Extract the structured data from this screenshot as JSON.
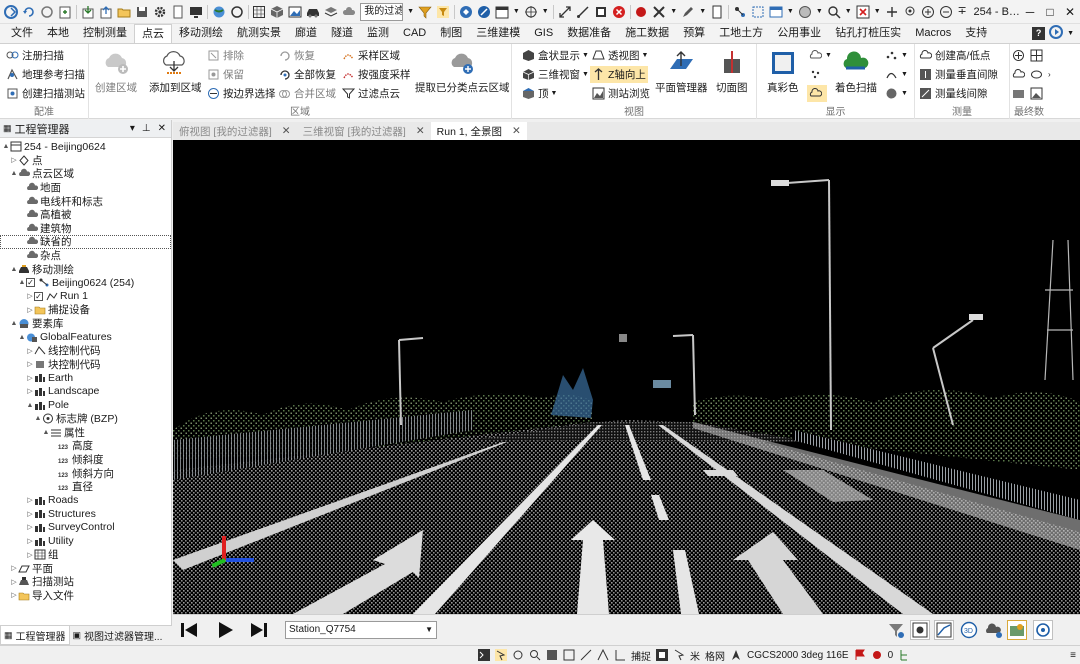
{
  "window": {
    "title": "254 - B…",
    "filter_combo": "我的过滤…"
  },
  "colors": {
    "ribbon_highlight": "#fde6a8",
    "accent_blue": "#2f6db5",
    "viewport_bg": "#000000",
    "road_white": "#e6e6e6"
  },
  "ribbon_tabs": [
    {
      "label": "文件"
    },
    {
      "label": "本地"
    },
    {
      "label": "控制测量"
    },
    {
      "label": "点云"
    },
    {
      "label": "移动测绘"
    },
    {
      "label": "航测实景"
    },
    {
      "label": "廊道"
    },
    {
      "label": "隧道"
    },
    {
      "label": "监测"
    },
    {
      "label": "CAD"
    },
    {
      "label": "制图"
    },
    {
      "label": "三维建模"
    },
    {
      "label": "GIS"
    },
    {
      "label": "数据准备"
    },
    {
      "label": "施工数据"
    },
    {
      "label": "预算"
    },
    {
      "label": "工地土方"
    },
    {
      "label": "公用事业"
    },
    {
      "label": "钻孔打桩压实"
    },
    {
      "label": "Macros"
    },
    {
      "label": "支持"
    }
  ],
  "ribbon": {
    "peizhun": {
      "label": "配准",
      "items": [
        {
          "label": "注册扫描",
          "icon": "register-scan-icon"
        },
        {
          "label": "地理参考扫描",
          "icon": "georeference-icon"
        },
        {
          "label": "创建扫描测站",
          "icon": "scan-station-icon"
        }
      ]
    },
    "quyu": {
      "label": "区域",
      "create_region": "创建区域",
      "add_to_region": "添加到区域",
      "small": [
        {
          "label": "排除",
          "icon": "exclude-icon"
        },
        {
          "label": "保留",
          "icon": "keep-icon"
        },
        {
          "label": "按边界选择",
          "icon": "boundary-select-icon"
        },
        {
          "label": "恢复",
          "icon": "restore-icon"
        },
        {
          "label": "全部恢复",
          "icon": "restore-all-icon"
        },
        {
          "label": "合并区域",
          "icon": "merge-region-icon"
        },
        {
          "label": "采样区域",
          "icon": "sample-region-icon"
        },
        {
          "label": "按强度采样",
          "icon": "intensity-sample-icon"
        },
        {
          "label": "过滤点云",
          "icon": "filter-cloud-icon"
        }
      ],
      "extract": "提取已分类点云区域"
    },
    "shitu": {
      "label": "视图",
      "small": [
        {
          "label": "盒状显示",
          "icon": "box-display-icon"
        },
        {
          "label": "三维视窗",
          "icon": "3d-window-icon"
        },
        {
          "label": "顶",
          "icon": "top-view-icon"
        },
        {
          "label": "透视图",
          "icon": "perspective-icon"
        },
        {
          "label": "Z轴向上",
          "icon": "z-up-icon"
        },
        {
          "label": "测站浏览",
          "icon": "station-browse-icon"
        }
      ],
      "plane_manager": "平面管理器",
      "cut_view": "切面图"
    },
    "xianshi": {
      "label": "显示",
      "true_color": "真彩色",
      "colored_scan": "着色扫描"
    },
    "celiang": {
      "label": "测量",
      "small": [
        {
          "label": "创建高/低点",
          "icon": "high-low-point-icon"
        },
        {
          "label": "测量垂直间隙",
          "icon": "vertical-clearance-icon"
        },
        {
          "label": "测量线间隙",
          "icon": "line-clearance-icon"
        }
      ]
    },
    "zuizhong": {
      "label": "最终数"
    }
  },
  "panel": {
    "title": "工程管理器",
    "tree": [
      {
        "label": "254 - Beijing0624",
        "icon": "project-icon"
      },
      {
        "label": "点",
        "icon": "point-icon"
      },
      {
        "label": "点云区域",
        "icon": "cloud-region-icon"
      },
      {
        "label": "地面",
        "icon": "cloud-region-icon"
      },
      {
        "label": "电线杆和标志",
        "icon": "cloud-region-icon"
      },
      {
        "label": "高植被",
        "icon": "cloud-region-icon"
      },
      {
        "label": "建筑物",
        "icon": "cloud-region-icon"
      },
      {
        "label": "缺省的",
        "icon": "cloud-region-icon"
      },
      {
        "label": "杂点",
        "icon": "cloud-region-icon"
      },
      {
        "label": "移动测绘",
        "icon": "mobile-mapping-icon"
      },
      {
        "label": "Beijing0624 (254)",
        "icon": "run-group-icon"
      },
      {
        "label": "Run 1",
        "icon": "run-icon"
      },
      {
        "label": "捕捉设备",
        "icon": "folder-icon"
      },
      {
        "label": "要素库",
        "icon": "feature-library-icon"
      },
      {
        "label": "GlobalFeatures",
        "icon": "global-features-icon"
      },
      {
        "label": "线控制代码",
        "icon": "line-code-icon"
      },
      {
        "label": "块控制代码",
        "icon": "block-code-icon"
      },
      {
        "label": "Earth",
        "icon": "feature-class-icon"
      },
      {
        "label": "Landscape",
        "icon": "feature-class-icon"
      },
      {
        "label": "Pole",
        "icon": "feature-class-icon"
      },
      {
        "label": "标志牌 (BZP)",
        "icon": "sign-feature-icon"
      },
      {
        "label": "属性",
        "icon": "attribute-list-icon"
      },
      {
        "label": "高度",
        "icon": "numeric-attribute-icon"
      },
      {
        "label": "倾斜度",
        "icon": "numeric-attribute-icon"
      },
      {
        "label": "倾斜方向",
        "icon": "numeric-attribute-icon"
      },
      {
        "label": "直径",
        "icon": "numeric-attribute-icon"
      },
      {
        "label": "Roads",
        "icon": "feature-class-icon"
      },
      {
        "label": "Structures",
        "icon": "feature-class-icon"
      },
      {
        "label": "SurveyControl",
        "icon": "feature-class-icon"
      },
      {
        "label": "Utility",
        "icon": "feature-class-icon"
      },
      {
        "label": "组",
        "icon": "group-icon"
      },
      {
        "label": "平面",
        "icon": "plane-icon"
      },
      {
        "label": "扫描测站",
        "icon": "scan-station-icon"
      },
      {
        "label": "导入文件",
        "icon": "folder-icon"
      }
    ],
    "tabs": [
      {
        "label": "工程管理器"
      },
      {
        "label": "视图过滤器管理..."
      }
    ]
  },
  "view_tabs": [
    {
      "label": "俯视图 [我的过滤器]"
    },
    {
      "label": "三维视窗 [我的过滤器]"
    },
    {
      "label": "Run 1, 全景图"
    }
  ],
  "playback": {
    "station": "Station_Q7754"
  },
  "status": {
    "snap": "捕捉",
    "meter": "米",
    "grid": "格网",
    "crs": "CGCS2000 3deg 116E",
    "count": "0"
  }
}
